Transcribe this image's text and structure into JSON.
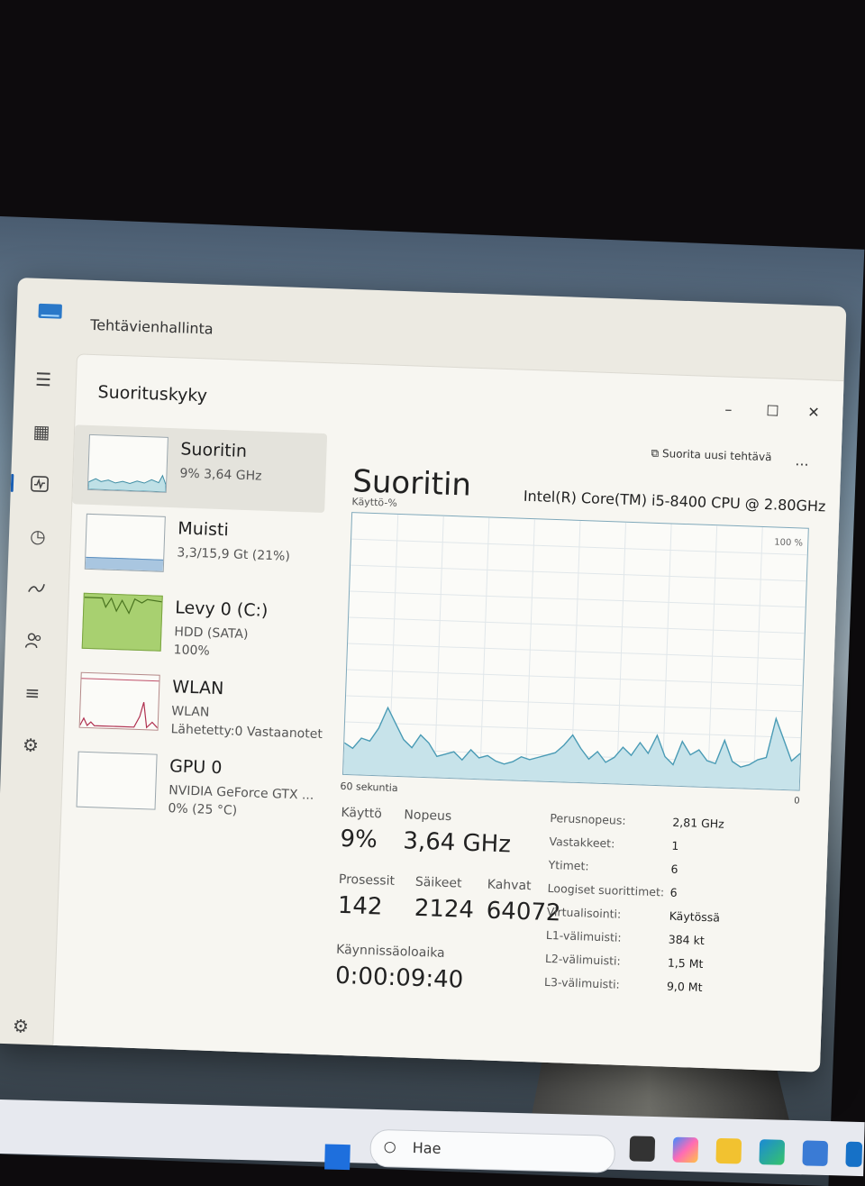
{
  "window": {
    "title": "Tehtävienhallinta"
  },
  "page": {
    "title": "Suorituskyky"
  },
  "nav": {
    "icons": [
      "hamburger-icon",
      "processes-icon",
      "performance-icon",
      "history-icon",
      "startup-icon",
      "users-icon",
      "details-icon",
      "services-icon",
      "settings-icon"
    ]
  },
  "list": [
    {
      "name": "Suoritin",
      "sub": "9% 3,64 GHz",
      "sub2": ""
    },
    {
      "name": "Muisti",
      "sub": "3,3/15,9 Gt (21%)",
      "sub2": ""
    },
    {
      "name": "Levy 0 (C:)",
      "sub": "HDD (SATA)",
      "sub2": "100%"
    },
    {
      "name": "WLAN",
      "sub": "WLAN",
      "sub2": "Lähetetty:0 Vastaanotet"
    },
    {
      "name": "GPU 0",
      "sub": "NVIDIA GeForce GTX ...",
      "sub2": "0% (25 °C)"
    }
  ],
  "toolbar": {
    "run_task": "Suorita uusi tehtävä",
    "more": "..."
  },
  "detail": {
    "title": "Suoritin",
    "model": "Intel(R) Core(TM) i5-8400 CPU @ 2.80GHz",
    "y_label": "Käyttö-%",
    "y_max": "100 %",
    "x_label": "60 sekuntia",
    "x_min": "0"
  },
  "stats": {
    "usage_label": "Käyttö",
    "usage": "9%",
    "speed_label": "Nopeus",
    "speed": "3,64 GHz",
    "processes_label": "Prosessit",
    "processes": "142",
    "threads_label": "Säikeet",
    "threads": "2124",
    "handles_label": "Kahvat",
    "handles": "64072",
    "uptime_label": "Käynnissäoloaika",
    "uptime": "0:00:09:40"
  },
  "specs": [
    {
      "k": "Perusnopeus:",
      "v": "2,81 GHz"
    },
    {
      "k": "Vastakkeet:",
      "v": "1"
    },
    {
      "k": "Ytimet:",
      "v": "6"
    },
    {
      "k": "Loogiset suorittimet:",
      "v": "6"
    },
    {
      "k": "Virtualisointi:",
      "v": "Käytössä"
    },
    {
      "k": "L1-välimuisti:",
      "v": "384 kt"
    },
    {
      "k": "L2-välimuisti:",
      "v": "1,5 Mt"
    },
    {
      "k": "L3-välimuisti:",
      "v": "9,0 Mt"
    }
  ],
  "chart_data": {
    "type": "area",
    "y_label": "Käyttö-%",
    "x_label": "60 sekuntia",
    "ylim": [
      0,
      100
    ],
    "grid": true,
    "values": [
      12,
      10,
      14,
      13,
      18,
      26,
      20,
      14,
      11,
      16,
      13,
      8,
      9,
      10,
      7,
      11,
      8,
      9,
      7,
      6,
      7,
      9,
      8,
      9,
      10,
      11,
      14,
      18,
      13,
      9,
      12,
      8,
      10,
      14,
      11,
      16,
      12,
      19,
      11,
      8,
      17,
      12,
      14,
      10,
      9,
      18,
      10,
      8,
      9,
      11,
      12,
      27,
      19,
      11,
      14
    ]
  },
  "taskbar": {
    "search_placeholder": "Hae"
  }
}
